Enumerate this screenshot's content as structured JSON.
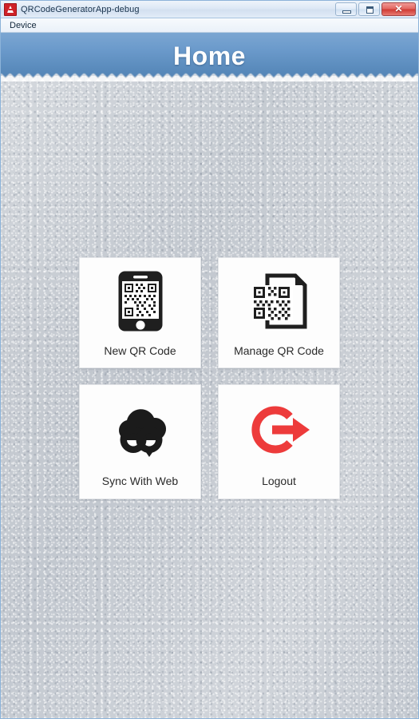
{
  "window": {
    "title": "QRCodeGeneratorApp-debug",
    "app_icon": "adobe-air-icon",
    "controls": {
      "minimize": "minimize-button",
      "maximize": "maximize-button",
      "close_glyph": "✕"
    },
    "menu": [
      {
        "label": "Device"
      }
    ]
  },
  "header": {
    "title": "Home",
    "gradient_top": "#7ba6d2",
    "gradient_bottom": "#4e80b2",
    "edge": "sawtooth"
  },
  "screen": {
    "background_color": "#c5cad1",
    "background_texture": "noisy-fabric"
  },
  "grid": {
    "cards": [
      {
        "id": "new-qr-code",
        "label": "New QR Code",
        "icon": "smartphone-qr-icon",
        "icon_color": "#1f1f1f"
      },
      {
        "id": "manage-qr-code",
        "label": "Manage QR Code",
        "icon": "document-qr-icon",
        "icon_color": "#1f1f1f"
      },
      {
        "id": "sync-with-web",
        "label": "Sync With Web",
        "icon": "cloud-sync-icon",
        "icon_color": "#1b1b1b"
      },
      {
        "id": "logout",
        "label": "Logout",
        "icon": "logout-arrow-icon",
        "icon_color": "#ed3b3b"
      }
    ]
  }
}
